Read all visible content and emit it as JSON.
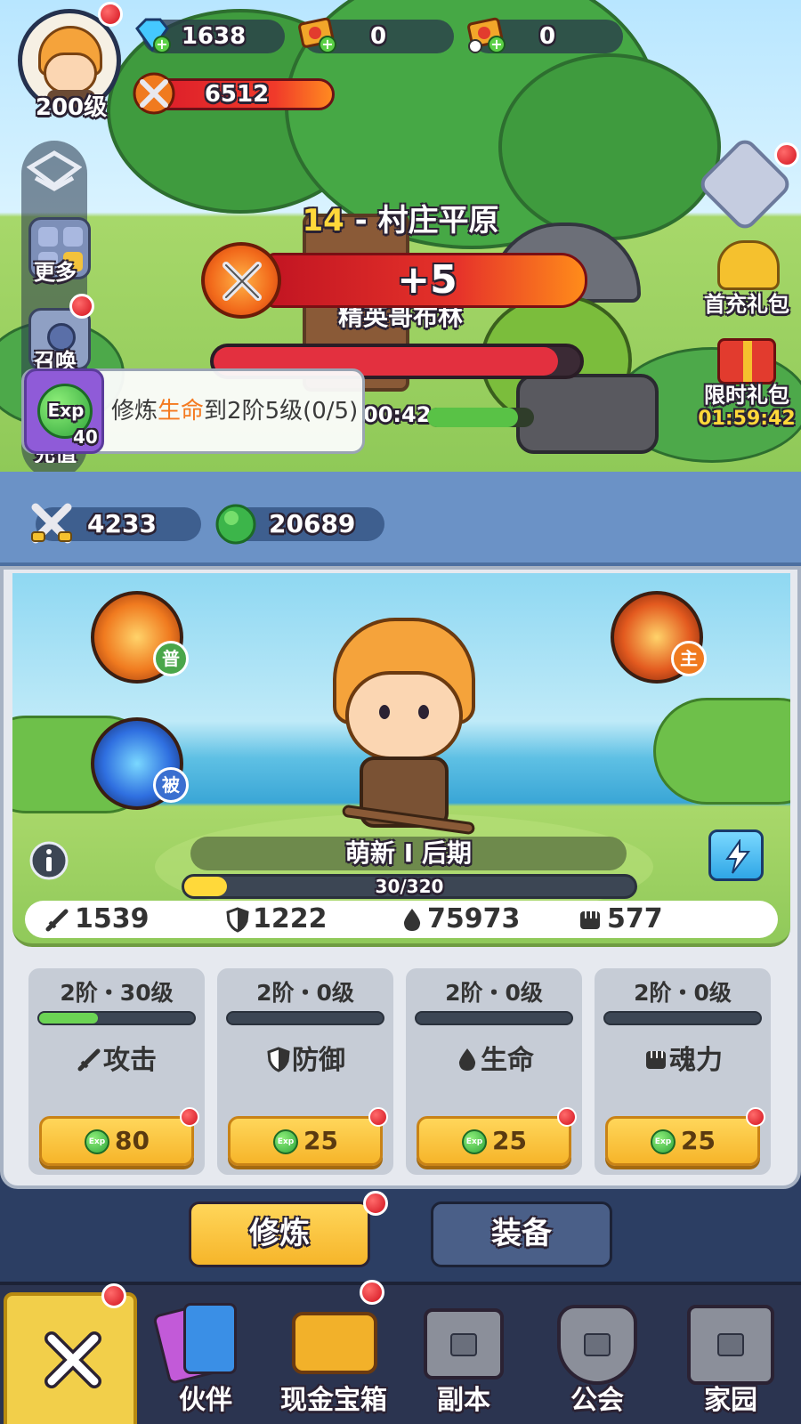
{
  "player": {
    "level": "200级"
  },
  "resources": [
    {
      "name": "gem",
      "value": "1638"
    },
    {
      "name": "ticket",
      "value": "0"
    },
    {
      "name": "timed-ticket",
      "value": "0"
    }
  ],
  "combat_power": "6512",
  "side_menu": {
    "more": "更多",
    "summon": "召唤",
    "recharge": "充值"
  },
  "stage": {
    "number": "14",
    "separator": " - ",
    "name": "村庄平原"
  },
  "power_gain": "+5",
  "enemy_name": "精英哥布林",
  "boss_timer": "00:42",
  "quest": {
    "badge": "40",
    "prefix": "修炼",
    "highlight": "生命",
    "suffix": "到2阶5级(0/5)"
  },
  "right_menu": {
    "first_pack": "首充礼包",
    "timed_pack": "限时礼包",
    "timed_pack_countdown": "01:59:42"
  },
  "currency": {
    "attack_power": "4233",
    "exp": "20689"
  },
  "hero": {
    "skills": {
      "normal": "普",
      "active": "主",
      "passive": "被"
    },
    "rank": "萌新 Ⅰ 后期",
    "exp_text": "30/320",
    "exp_fraction": 0.094,
    "stats": {
      "attack": "1539",
      "defense": "1222",
      "hp": "75973",
      "soul": "577"
    }
  },
  "training": [
    {
      "level": "2阶・30级",
      "progress": 0.38,
      "label": "攻击",
      "cost": "80"
    },
    {
      "level": "2阶・0级",
      "progress": 0,
      "label": "防御",
      "cost": "25"
    },
    {
      "level": "2阶・0级",
      "progress": 0,
      "label": "生命",
      "cost": "25"
    },
    {
      "level": "2阶・0级",
      "progress": 0,
      "label": "魂力",
      "cost": "25"
    }
  ],
  "tabs": {
    "train": "修炼",
    "equip": "装备"
  },
  "nav": {
    "partner": "伙伴",
    "chest": "现金宝箱",
    "dungeon": "副本",
    "guild": "公会",
    "home": "家园"
  },
  "exp_coin_text": "Exp",
  "colors": {
    "accent_gold": "#f6b52a",
    "panel_blue": "#6b92c6",
    "alert_red": "#d2121e"
  }
}
